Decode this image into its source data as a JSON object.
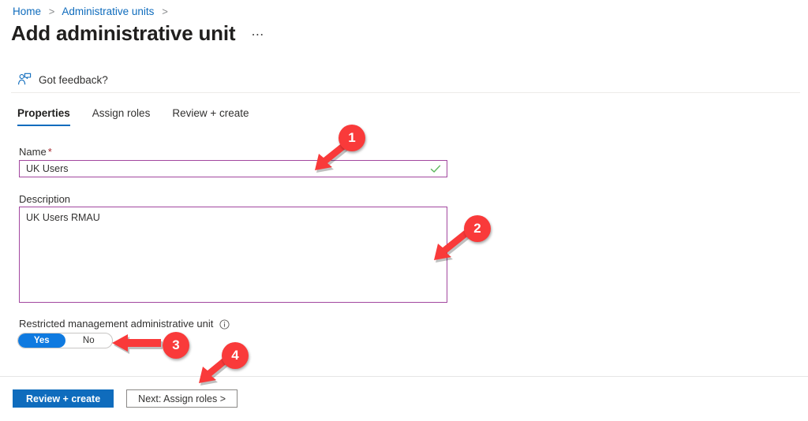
{
  "breadcrumb": {
    "items": [
      {
        "label": "Home",
        "icon": ""
      },
      {
        "label": "Administrative units",
        "icon": ""
      }
    ],
    "separator": ">"
  },
  "header": {
    "title": "Add administrative unit",
    "ellipsis": "⋯"
  },
  "commandbar": {
    "feedback_label": "Got feedback?",
    "feedback_icon": "person-feedback-icon"
  },
  "tabs": [
    {
      "label": "Properties",
      "active": true
    },
    {
      "label": "Assign roles",
      "active": false
    },
    {
      "label": "Review + create",
      "active": false
    }
  ],
  "form": {
    "name": {
      "label": "Name",
      "required_marker": "*",
      "value": "UK Users",
      "placeholder": "",
      "valid_icon": "green-check-icon",
      "border_color": "#a2479f"
    },
    "description": {
      "label": "Description",
      "value": "UK Users RMAU",
      "placeholder": "",
      "border_color": "#a2479f"
    },
    "restricted_management": {
      "label": "Restricted management administrative unit",
      "info_icon": "info-circle-icon",
      "options": [
        "Yes",
        "No"
      ],
      "selected": "Yes",
      "selected_color": "#0f7ae0"
    }
  },
  "footer": {
    "primary_button": "Review + create",
    "secondary_button": "Next: Assign roles >",
    "primary_color": "#0f6cbd"
  },
  "annotations": {
    "color": "#f93a3a",
    "markers": [
      {
        "number": "1",
        "target": "name-input",
        "arrow_direction": "down-left"
      },
      {
        "number": "2",
        "target": "description-textarea",
        "arrow_direction": "down-left"
      },
      {
        "number": "3",
        "target": "restricted-management-toggle",
        "arrow_direction": "left"
      },
      {
        "number": "4",
        "target": "next-assign-roles-button",
        "arrow_direction": "down-left"
      }
    ]
  }
}
